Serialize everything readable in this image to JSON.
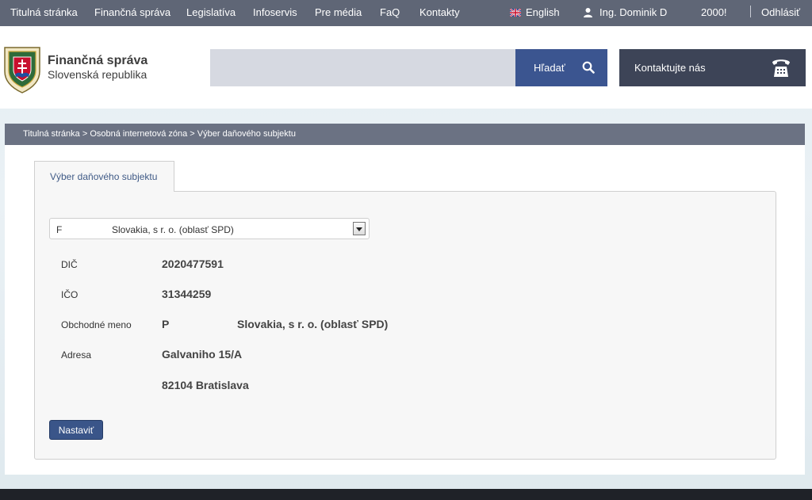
{
  "topnav": {
    "items": [
      "Titulná stránka",
      "Finančná správa",
      "Legislatíva",
      "Infoservis",
      "Pre média",
      "FaQ",
      "Kontakty"
    ],
    "language": "English",
    "user": "Ing. Dominik D",
    "user_id": "2000!",
    "logout": "Odhlásiť"
  },
  "header": {
    "logo_line1": "Finančná správa",
    "logo_line2": "Slovenská republika",
    "search_value": "",
    "search_button": "Hľadať",
    "contact_button": "Kontaktujte nás"
  },
  "breadcrumb": {
    "items": [
      "Titulná stránka",
      "Osobná internetová zóna",
      "Výber daňového subjektu"
    ],
    "separator": ">"
  },
  "content": {
    "tab": "Výber daňového subjektu",
    "select": {
      "code": "F",
      "name": "Slovakia, s r. o. (oblasť SPD)"
    },
    "fields": {
      "dic_label": "DIČ",
      "dic_value": "2020477591",
      "ico_label": "IČO",
      "ico_value": "31344259",
      "name_label": "Obchodné meno",
      "name_code": "P",
      "name_value": "Slovakia, s r. o. (oblasť SPD)",
      "address_label": "Adresa",
      "address_line1": "Galvaniho 15/A",
      "address_line2": "82104 Bratislava"
    },
    "submit_button": "Nastaviť"
  },
  "colors": {
    "topbar": "#5f6676",
    "search_button": "#3b5590",
    "contact_button": "#3d4457",
    "breadcrumb": "#6b7283",
    "primary_button": "#3a5589"
  }
}
